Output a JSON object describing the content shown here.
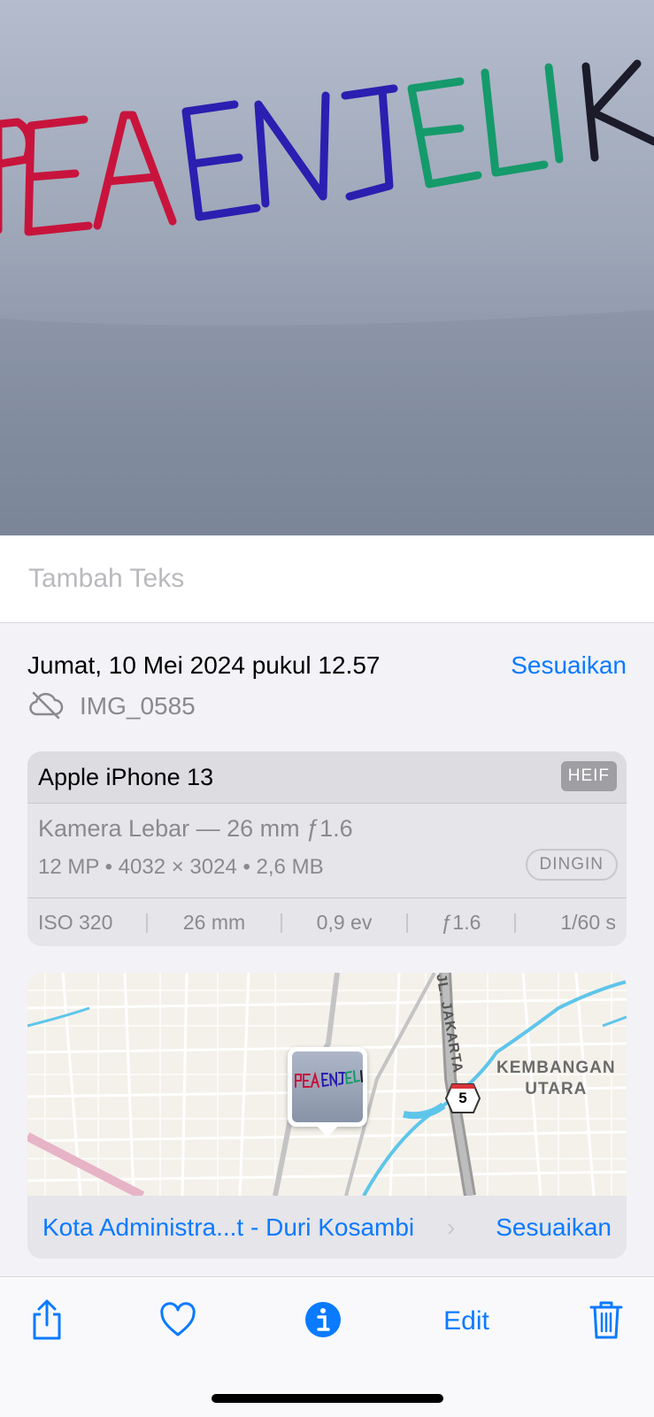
{
  "photo": {
    "handwriting_text": "PEAENJELIK"
  },
  "caption": {
    "placeholder": "Tambah Teks"
  },
  "info": {
    "date": "Jumat, 10 Mei 2024 pukul 12.57",
    "adjust_label": "Sesuaikan",
    "filename": "IMG_0585",
    "cloud_icon": "cloud-off-icon"
  },
  "exif": {
    "model": "Apple iPhone 13",
    "format_badge": "HEIF",
    "lens": "Kamera Lebar — 26 mm ƒ1.6",
    "specs": "12 MP  •  4032 × 3024  •  2,6 MB",
    "style_badge": "DINGIN",
    "stats": [
      "ISO 320",
      "26 mm",
      "0,9 ev",
      "ƒ1.6",
      "1/60 s"
    ]
  },
  "map": {
    "area_label": "KEMBANGAN\nUTARA",
    "road_label": "JL. JAKARTA",
    "route_number": "5",
    "location": "Kota Administra...t - Duri Kosambi",
    "chevron": "›",
    "adjust_label": "Sesuaikan"
  },
  "toolbar": {
    "share_icon": "share-icon",
    "favorite_icon": "heart-icon",
    "info_icon": "info-icon",
    "edit_label": "Edit",
    "delete_icon": "trash-icon"
  },
  "colors": {
    "accent": "#0a7aff",
    "ink_red": "#c8143c",
    "ink_blue": "#2a1fb0",
    "ink_green": "#159a6b",
    "ink_black": "#1b1b2a"
  }
}
